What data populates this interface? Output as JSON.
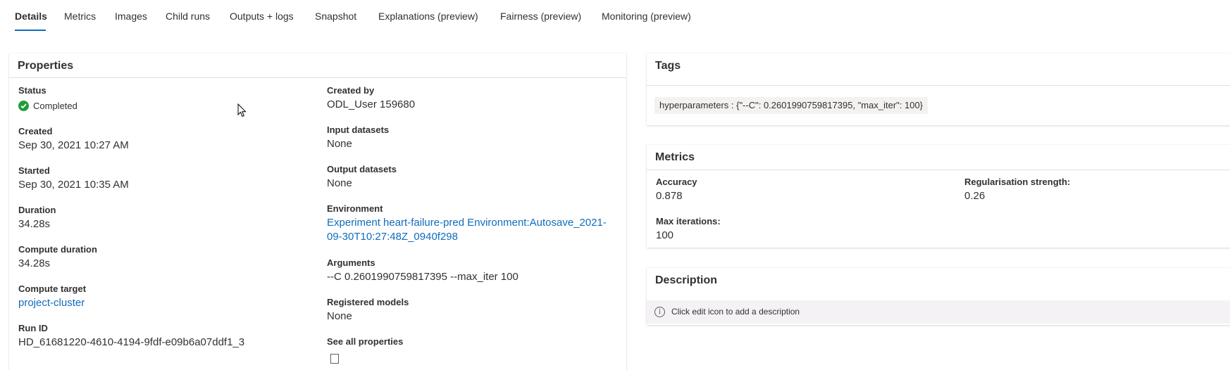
{
  "tabs": [
    {
      "label": "Details"
    },
    {
      "label": "Metrics"
    },
    {
      "label": "Images"
    },
    {
      "label": "Child runs"
    },
    {
      "label": "Outputs + logs"
    },
    {
      "label": "Snapshot"
    },
    {
      "label": "Explanations (preview)"
    },
    {
      "label": "Fairness (preview)"
    },
    {
      "label": "Monitoring (preview)"
    }
  ],
  "active_tab": "Details",
  "properties": {
    "title": "Properties",
    "status_label": "Status",
    "status_value": "Completed",
    "created_label": "Created",
    "created_value": "Sep 30, 2021 10:27 AM",
    "started_label": "Started",
    "started_value": "Sep 30, 2021 10:35 AM",
    "duration_label": "Duration",
    "duration_value": "34.28s",
    "compute_duration_label": "Compute duration",
    "compute_duration_value": "34.28s",
    "compute_target_label": "Compute target",
    "compute_target_value": "project-cluster",
    "run_id_label": "Run ID",
    "run_id_value": "HD_61681220-4610-4194-9fdf-e09b6a07ddf1_3",
    "created_by_label": "Created by",
    "created_by_value": "ODL_User 159680",
    "input_datasets_label": "Input datasets",
    "input_datasets_value": "None",
    "output_datasets_label": "Output datasets",
    "output_datasets_value": "None",
    "environment_label": "Environment",
    "environment_value_line1": "Experiment heart-failure-pred Environment:Autosave_2021-",
    "environment_value_line2": "09-30T10:27:48Z_0940f298",
    "arguments_label": "Arguments",
    "arguments_value": "--C 0.2601990759817395 --max_iter 100",
    "registered_models_label": "Registered models",
    "registered_models_value": "None",
    "see_all_label": "See all properties"
  },
  "tags": {
    "title": "Tags",
    "chip": "hyperparameters : {\"--C\": 0.2601990759817395, \"max_iter\": 100}"
  },
  "metrics": {
    "title": "Metrics",
    "accuracy_label": "Accuracy",
    "accuracy_value": "0.878",
    "reg_label": "Regularisation strength:",
    "reg_value": "0.26",
    "max_iter_label": "Max iterations:",
    "max_iter_value": "100"
  },
  "description": {
    "title": "Description",
    "hint": "Click edit icon to add a description"
  },
  "colors": {
    "accent": "#0f6cbd",
    "success": "#1e9e3a"
  }
}
